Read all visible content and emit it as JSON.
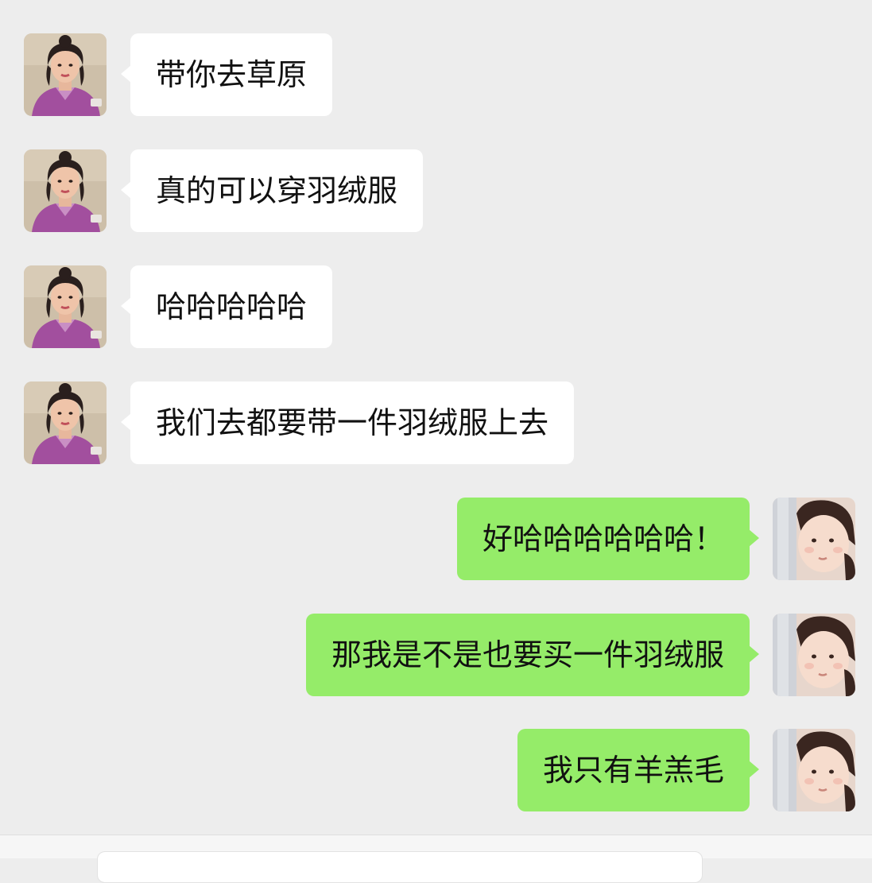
{
  "colors": {
    "background": "#ededed",
    "incoming_bubble": "#ffffff",
    "outgoing_bubble": "#95ec69",
    "text": "#111111"
  },
  "messages": [
    {
      "direction": "incoming",
      "text": "带你去草原",
      "avatar": "contact-avatar"
    },
    {
      "direction": "incoming",
      "text": "真的可以穿羽绒服",
      "avatar": "contact-avatar"
    },
    {
      "direction": "incoming",
      "text": "哈哈哈哈哈",
      "avatar": "contact-avatar"
    },
    {
      "direction": "incoming",
      "text": "我们去都要带一件羽绒服上去",
      "avatar": "contact-avatar"
    },
    {
      "direction": "outgoing",
      "text": "好哈哈哈哈哈哈！",
      "avatar": "user-avatar"
    },
    {
      "direction": "outgoing",
      "text": "那我是不是也要买一件羽绒服",
      "avatar": "user-avatar"
    },
    {
      "direction": "outgoing",
      "text": "我只有羊羔毛",
      "avatar": "user-avatar"
    }
  ]
}
